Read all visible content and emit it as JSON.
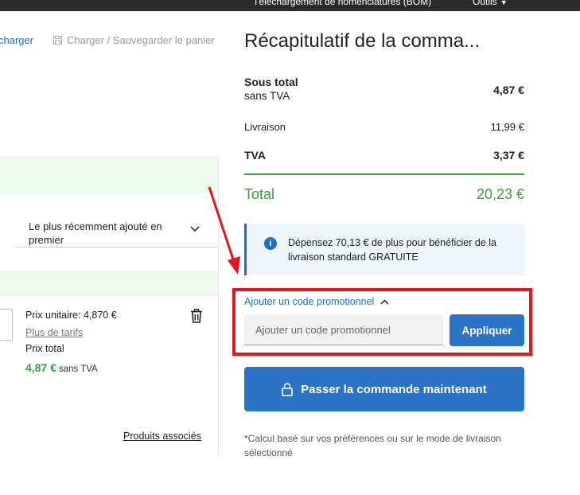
{
  "topbar": {
    "bom_link": "Téléchargement de nomenclatures (BOM)",
    "tools_menu": "Outils"
  },
  "cart_actions": {
    "load": "charger",
    "save": "Charger / Sauvegarder le panier"
  },
  "sort": {
    "selected": "Le plus récemment ajouté en premier"
  },
  "product": {
    "unit_price": "Prix unitaire: 4,870 €",
    "more_prices": "Plus de tarifs",
    "total_label": "Prix total",
    "total_value": "4,87 €",
    "total_suffix": "sans TVA",
    "related": "Produits associés"
  },
  "summary": {
    "title": "Récapitulatif de la comma...",
    "subtotal_label": "Sous total",
    "subtotal_sub": "sans TVA",
    "subtotal_value": "4,87 €",
    "shipping_label": "Livraison",
    "shipping_value": "11,99 €",
    "vat_label": "TVA",
    "vat_value": "3,37 €",
    "total_label": "Total",
    "total_value": "20,23 €",
    "info_text": "Dépensez 70,13 € de plus pour bénéficier de la livraison standard GRATUITE",
    "promo_toggle": "Ajouter un code promotionnel",
    "promo_placeholder": "Ajouter un code promotionnel",
    "apply": "Appliquer",
    "checkout": "Passer la commande maintenant",
    "footnote": "*Calcul basé sur vos préférences ou sur le mode de livraison sélectionné"
  },
  "colors": {
    "accent_blue": "#2a73c5",
    "total_green": "#3d9a43",
    "highlight_red": "#e8141c"
  }
}
